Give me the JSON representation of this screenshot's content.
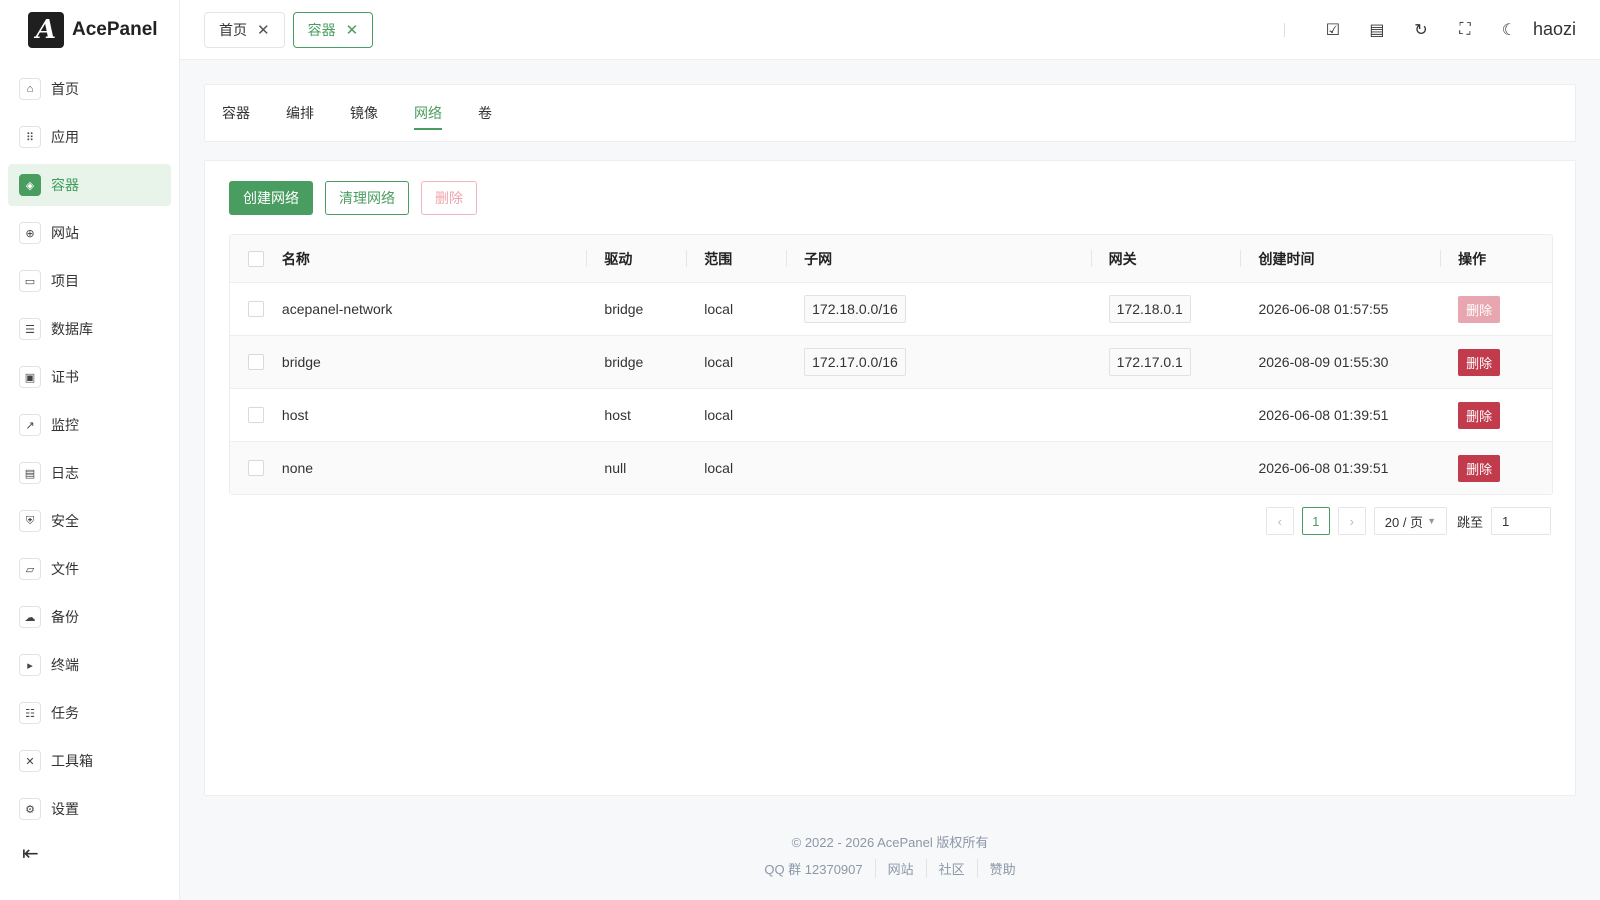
{
  "brand": {
    "logo_letter": "A",
    "name": "AcePanel"
  },
  "sidebar": {
    "items": [
      {
        "label": "首页",
        "icon": "⌂"
      },
      {
        "label": "应用",
        "icon": "⠿"
      },
      {
        "label": "容器",
        "icon": "◈"
      },
      {
        "label": "网站",
        "icon": "⊕"
      },
      {
        "label": "项目",
        "icon": "▭"
      },
      {
        "label": "数据库",
        "icon": "☰"
      },
      {
        "label": "证书",
        "icon": "▣"
      },
      {
        "label": "监控",
        "icon": "↗"
      },
      {
        "label": "日志",
        "icon": "▤"
      },
      {
        "label": "安全",
        "icon": "⛨"
      },
      {
        "label": "文件",
        "icon": "▱"
      },
      {
        "label": "备份",
        "icon": "☁"
      },
      {
        "label": "终端",
        "icon": "▸"
      },
      {
        "label": "任务",
        "icon": "☷"
      },
      {
        "label": "工具箱",
        "icon": "✕"
      },
      {
        "label": "设置",
        "icon": "⚙"
      }
    ],
    "active_index": 2,
    "collapse_icon": "⇤"
  },
  "topbar": {
    "tabs": [
      {
        "label": "首页",
        "close": "✕"
      },
      {
        "label": "容器",
        "close": "✕"
      }
    ],
    "icons": {
      "tasks": "☑",
      "doc": "▤",
      "refresh": "↻",
      "fullscreen": "⛶",
      "theme": "☾"
    },
    "username": "haozi"
  },
  "subtabs": [
    "容器",
    "编排",
    "镜像",
    "网络",
    "卷"
  ],
  "actions": {
    "create": "创建网络",
    "prune": "清理网络",
    "delete": "删除"
  },
  "table": {
    "headers": {
      "name": "名称",
      "driver": "驱动",
      "scope": "范围",
      "subnet": "子网",
      "gateway": "网关",
      "created": "创建时间",
      "op": "操作"
    },
    "rows": [
      {
        "name": "acepanel-network",
        "driver": "bridge",
        "scope": "local",
        "subnet": "172.18.0.0/16",
        "gateway": "172.18.0.1",
        "created": "2026-06-08 01:57:55",
        "op": "删除"
      },
      {
        "name": "bridge",
        "driver": "bridge",
        "scope": "local",
        "subnet": "172.17.0.0/16",
        "gateway": "172.17.0.1",
        "created": "2026-08-09 01:55:30",
        "op": "删除"
      },
      {
        "name": "host",
        "driver": "host",
        "scope": "local",
        "subnet": "",
        "gateway": "",
        "created": "2026-06-08 01:39:51",
        "op": "删除"
      },
      {
        "name": "none",
        "driver": "null",
        "scope": "local",
        "subnet": "",
        "gateway": "",
        "created": "2026-06-08 01:39:51",
        "op": "删除"
      }
    ]
  },
  "pagination": {
    "prev": "‹",
    "next": "›",
    "current": "1",
    "page_size": "20 / 页",
    "jump_label": "跳至",
    "jump_value": "1"
  },
  "footer": {
    "copyright": "© 2022 - 2026 AcePanel 版权所有",
    "qq": "QQ 群 12370907",
    "links": [
      "网站",
      "社区",
      "赞助"
    ]
  },
  "colors": {
    "accent": "#4a9d60",
    "danger": "#c23b4d",
    "danger_disabled": "#e8a7b0"
  }
}
